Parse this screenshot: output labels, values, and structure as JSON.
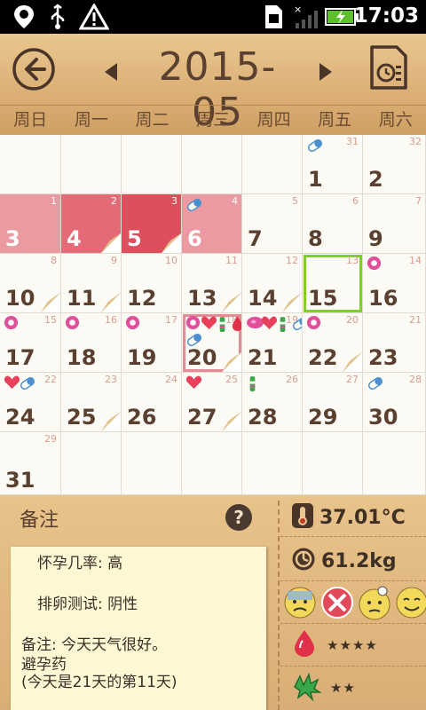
{
  "status_bar": {
    "time": "17:03",
    "icons": [
      "location-pin-icon",
      "usb-icon",
      "warning-icon",
      "sim-card-icon",
      "signal-icon",
      "battery-charging-icon"
    ]
  },
  "header": {
    "month": "2015-05",
    "back_icon": "back-arrow-icon",
    "prev_icon": "prev-month-icon",
    "next_icon": "next-month-icon",
    "report_icon": "report-icon",
    "weekdays": [
      "周日",
      "周一",
      "周二",
      "周三",
      "周四",
      "周五",
      "周六"
    ]
  },
  "calendar": {
    "rows": [
      [
        {
          "d": "",
          "l": ""
        },
        {
          "d": "",
          "l": ""
        },
        {
          "d": "",
          "l": ""
        },
        {
          "d": "",
          "l": ""
        },
        {
          "d": "",
          "l": ""
        },
        {
          "d": "1",
          "l": "31",
          "icons": [
            "pill"
          ]
        },
        {
          "d": "2",
          "l": "32"
        }
      ],
      [
        {
          "d": "3",
          "l": "1",
          "bg": "pinkL"
        },
        {
          "d": "4",
          "l": "2",
          "bg": "pinkM",
          "curl": true
        },
        {
          "d": "5",
          "l": "3",
          "bg": "pinkD",
          "curl": true
        },
        {
          "d": "6",
          "l": "4",
          "bg": "pinkL",
          "icons": [
            "pill"
          ]
        },
        {
          "d": "7",
          "l": "5"
        },
        {
          "d": "8",
          "l": "6"
        },
        {
          "d": "9",
          "l": "7"
        }
      ],
      [
        {
          "d": "10",
          "l": "8",
          "curl": true
        },
        {
          "d": "11",
          "l": "9",
          "curl": true
        },
        {
          "d": "12",
          "l": "10"
        },
        {
          "d": "13",
          "l": "11",
          "curl": true
        },
        {
          "d": "14",
          "l": "12",
          "curl": true
        },
        {
          "d": "15",
          "l": "13",
          "today": true
        },
        {
          "d": "16",
          "l": "14",
          "icons": [
            "flower"
          ]
        }
      ],
      [
        {
          "d": "17",
          "l": "15",
          "icons": [
            "flower"
          ]
        },
        {
          "d": "18",
          "l": "16",
          "icons": [
            "flower"
          ]
        },
        {
          "d": "19",
          "l": "17",
          "icons": [
            "flower"
          ]
        },
        {
          "d": "20",
          "l": "18",
          "selected": true,
          "curl": true,
          "icons": [
            "flower",
            "heart",
            "test",
            "drop",
            "pill"
          ]
        },
        {
          "d": "21",
          "l": "19",
          "icons": [
            "flower2",
            "heart",
            "test",
            "pill"
          ]
        },
        {
          "d": "22",
          "l": "20",
          "curl": true,
          "icons": [
            "flower"
          ]
        },
        {
          "d": "23",
          "l": "21"
        }
      ],
      [
        {
          "d": "24",
          "l": "22",
          "icons": [
            "heart",
            "pill"
          ]
        },
        {
          "d": "25",
          "l": "23",
          "curl": true
        },
        {
          "d": "26",
          "l": "24"
        },
        {
          "d": "27",
          "l": "25",
          "curl": true,
          "icons": [
            "heart"
          ]
        },
        {
          "d": "28",
          "l": "26",
          "icons": [
            "test"
          ]
        },
        {
          "d": "29",
          "l": "27"
        },
        {
          "d": "30",
          "l": "28",
          "icons": [
            "pill"
          ]
        }
      ],
      [
        {
          "d": "31",
          "l": "29"
        },
        {
          "d": "",
          "l": ""
        },
        {
          "d": "",
          "l": ""
        },
        {
          "d": "",
          "l": ""
        },
        {
          "d": "",
          "l": ""
        },
        {
          "d": "",
          "l": ""
        },
        {
          "d": "",
          "l": ""
        }
      ]
    ]
  },
  "notes": {
    "title": "备注",
    "help": "?",
    "lines": [
      "怀孕几率: 高",
      "",
      "排卵测试:  阴性",
      "",
      "备注:  今天天气很好。",
      "避孕药",
      "(今天是21天的第11天)"
    ]
  },
  "stats": {
    "temperature": "37.01°C",
    "weight": "61.2kg",
    "flow_stars": "★★★★",
    "pain_stars": "★★"
  },
  "colors": {
    "header_bg": "#dcb178",
    "period_light": "#ec9aa2",
    "period_mid": "#e56a78",
    "period_dark": "#de4f5d",
    "today_border": "#7cd02c",
    "selected_border": "#e58b95"
  }
}
